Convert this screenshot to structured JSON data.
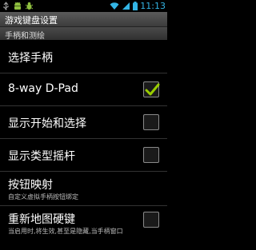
{
  "status_bar": {
    "time": "11:13",
    "left_icons": [
      "usb-icon",
      "android-icon",
      "bug-icon"
    ],
    "right_icons": [
      "wifi-icon",
      "signal-icon",
      "battery-icon"
    ]
  },
  "title": "游戏键盘设置",
  "section": "手柄和测绘",
  "rows": [
    {
      "label": "选择手柄"
    },
    {
      "label": "8-way D-Pad",
      "checked": true
    },
    {
      "label": "显示开始和选择",
      "checked": false
    },
    {
      "label": "显示类型摇杆",
      "checked": false
    },
    {
      "label": "按钮映射",
      "summary": "自定义虚拟手柄按钮绑定"
    },
    {
      "label": "重新地图硬键",
      "summary": "当启用时,将生效,甚至是隐藏,当手柄窗口",
      "checked": false
    }
  ],
  "colors": {
    "accent": "#33b5e5",
    "check": "#99cc00"
  }
}
